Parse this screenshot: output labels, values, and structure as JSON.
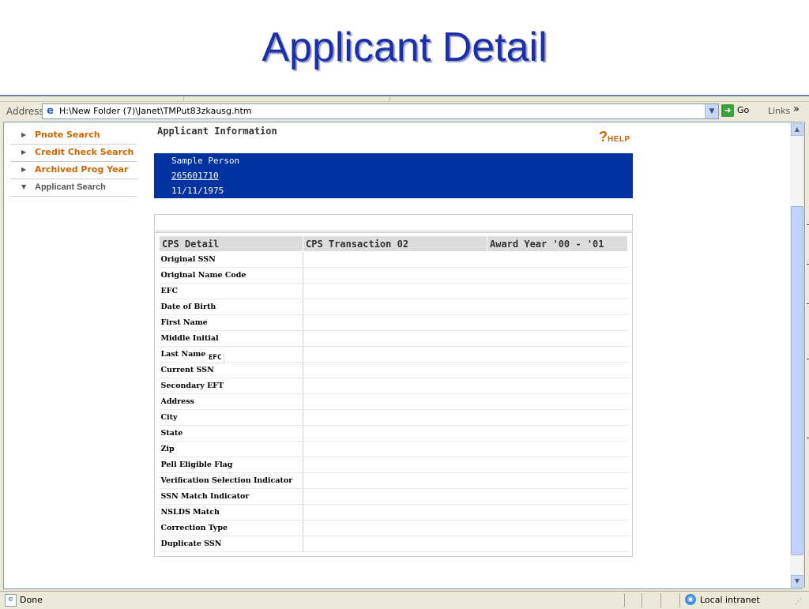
{
  "slide": {
    "title": "Applicant Detail"
  },
  "browser": {
    "address_label": "Address",
    "address_url": "H:\\New Folder (7)\\Janet\\TMPut83zkausg.htm",
    "go_label": "Go",
    "links_label": "Links",
    "links_chevron": "»",
    "status_text": "Done",
    "zone_text": "Local intranet"
  },
  "nav": {
    "items": [
      {
        "label": "Pnote Search"
      },
      {
        "label": "Credit Check Search"
      },
      {
        "label": "Archived Prog Year"
      },
      {
        "label": "Applicant Search"
      }
    ]
  },
  "section": {
    "title": "Applicant Information",
    "help_label": "HELP"
  },
  "applicant": {
    "name": "Sample Person",
    "ssn": "265601710",
    "dob": "11/11/1975"
  },
  "table": {
    "headers": [
      "CPS Detail",
      "CPS Transaction 02",
      "Award Year '00 - '01"
    ],
    "rows": [
      "Original SSN",
      "Original Name Code",
      "EFC",
      "Date of Birth",
      "First Name",
      "Middle Initial",
      "Last Name",
      "Current SSN",
      "Secondary EFT",
      "Address",
      "City",
      "State",
      "Zip",
      "Pell Eligible Flag",
      "Verification Selection Indicator",
      "SSN Match Indicator",
      "NSLDS Match",
      "Correction Type",
      "Duplicate SSN"
    ]
  },
  "tooltip": {
    "text": "EFC"
  },
  "colors": {
    "title_blue": "#1a2fa8",
    "banner_blue": "#0032a0",
    "nav_orange": "#cc6600"
  }
}
